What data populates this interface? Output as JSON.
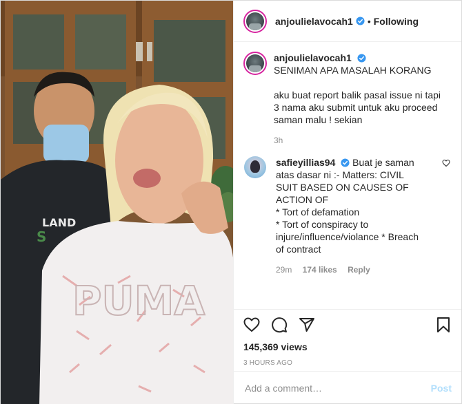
{
  "header": {
    "username": "anjoulielavocah1",
    "separator": "•",
    "follow_status": "Following",
    "verified_icon": "verified-badge-icon"
  },
  "caption": {
    "username": "anjoulielavocah1",
    "lines": [
      "SENIMAN APA MASALAH KORANG",
      "",
      "aku buat report balik pasal issue ni tapi",
      "3 nama aku submit untuk aku proceed",
      "saman malu ! sekian"
    ],
    "age": "3h"
  },
  "comment": {
    "username": "safieyillias94",
    "lines": [
      "Buat je saman",
      "atas dasar ni :- Matters: CIVIL",
      "SUIT BASED ON CAUSES OF",
      "ACTION OF",
      "* Tort of defamation",
      "* Tort of conspiracy to",
      "injure/influence/violance * Breach",
      "of contract"
    ],
    "age": "29m",
    "likes": "174 likes",
    "reply": "Reply"
  },
  "actions": {
    "icons": [
      "heart-icon",
      "comment-icon",
      "share-icon",
      "bookmark-icon"
    ],
    "views": "145,369 views",
    "posted": "3 HOURS AGO"
  },
  "composer": {
    "placeholder": "Add a comment…",
    "post_label": "Post"
  },
  "colors": {
    "verified": "#3897f0",
    "post_button_disabled": "#b2dffc",
    "muted_text": "#8e8e8e"
  }
}
